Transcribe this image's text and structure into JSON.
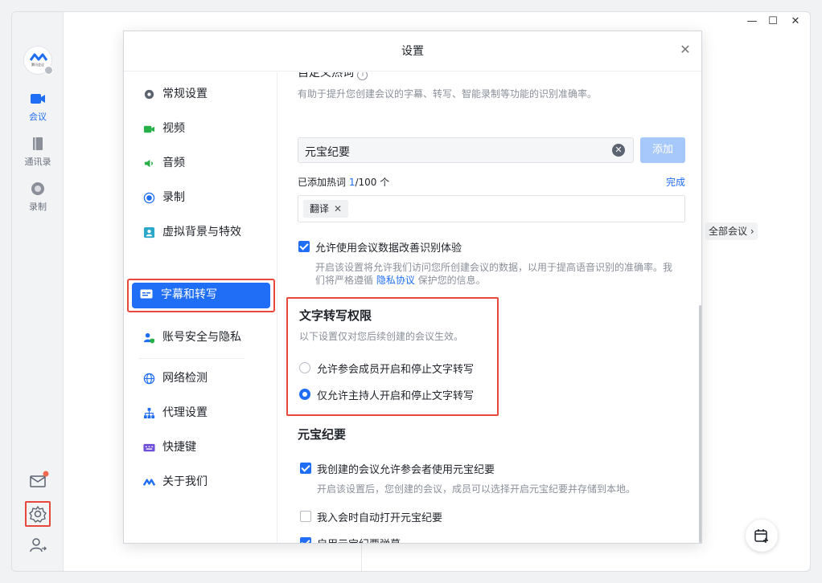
{
  "window": {
    "min": "—",
    "max": "☐",
    "close": "✕"
  },
  "rail": {
    "logo_text": "腾讯会议",
    "items": [
      {
        "label": "会议"
      },
      {
        "label": "通讯录"
      },
      {
        "label": "录制"
      }
    ]
  },
  "main": {
    "all_meetings": "全部会议"
  },
  "dialog": {
    "title": "设置",
    "nav": [
      {
        "label": "常规设置",
        "icon": "gear-icon"
      },
      {
        "label": "视频",
        "icon": "video-icon"
      },
      {
        "label": "音频",
        "icon": "speaker-icon"
      },
      {
        "label": "录制",
        "icon": "record-icon"
      },
      {
        "label": "虚拟背景与特效",
        "icon": "portrait-icon"
      },
      {
        "label": "字幕和转写",
        "icon": "caption-icon"
      },
      {
        "label": "账号安全与隐私",
        "icon": "user-shield-icon"
      },
      {
        "label": "网络检测",
        "icon": "globe-icon"
      },
      {
        "label": "代理设置",
        "icon": "network-icon"
      },
      {
        "label": "快捷键",
        "icon": "keyboard-icon"
      },
      {
        "label": "关于我们",
        "icon": "logo-icon"
      }
    ],
    "content": {
      "hotwords_title": "自定义热词",
      "hotwords_desc": "有助于提升您创建会议的字幕、转写、智能录制等功能的识别准确率。",
      "hotword_input": "元宝纪要",
      "add_button": "添加",
      "added_prefix": "已添加热词 ",
      "added_count": "1",
      "added_suffix": "/100 个",
      "done": "完成",
      "tag": "翻译",
      "allow_data_label": "允许使用会议数据改善识别体验",
      "allow_data_desc_1": "开启该设置将允许我们访问您所创建会议的数据，以用于提高语音识别的准确率。我",
      "allow_data_desc_2a": "们将严格遵循 ",
      "allow_data_link": "隐私协议",
      "allow_data_desc_2b": " 保护您的信息。",
      "perm_title": "文字转写权限",
      "perm_desc": "以下设置仅对您后续创建的会议生效。",
      "perm_opt1": "允许参会成员开启和停止文字转写",
      "perm_opt2": "仅允许主持人开启和停止文字转写",
      "yb_title": "元宝纪要",
      "yb_opt1": "我创建的会议允许参会者使用元宝纪要",
      "yb_opt1_desc": "开启该设置后，您创建的会议，成员可以选择开启元宝纪要并存储到本地。",
      "yb_opt2": "我入会时自动打开元宝纪要",
      "yb_opt3": "启用元宝纪要弹幕"
    }
  },
  "colors": {
    "accent": "#1f6ef5",
    "highlight": "#e8483c"
  }
}
